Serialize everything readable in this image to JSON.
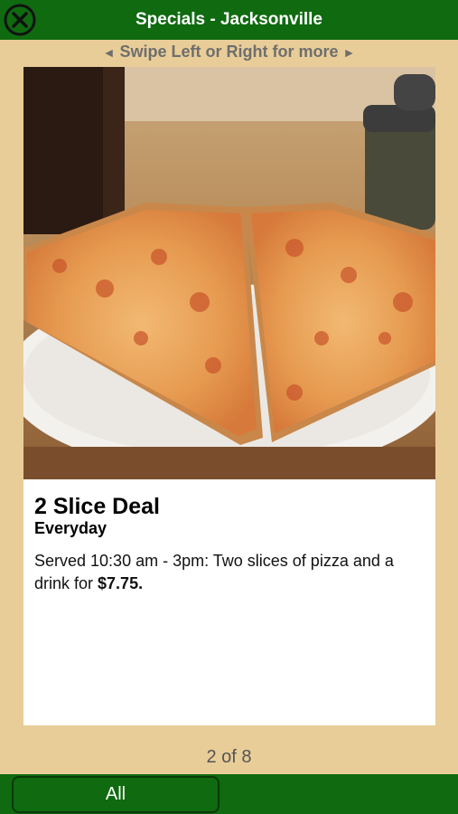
{
  "header": {
    "title": "Specials - Jacksonville",
    "close_icon": "close-circle-icon",
    "swipe_hint": "Swipe Left or Right for more",
    "left_arrow": "◄",
    "right_arrow": "►"
  },
  "special": {
    "title": "2 Slice Deal",
    "subtitle": "Everyday",
    "description_pre": "Served 10:30 am - 3pm: Two slices of pizza and a drink for ",
    "price": "$7.75."
  },
  "pager": {
    "text": "2 of 8"
  },
  "footer": {
    "all_label": "All"
  },
  "colors": {
    "bar": "#0f6a10",
    "background": "#e9cd98",
    "card": "#ffffff"
  }
}
